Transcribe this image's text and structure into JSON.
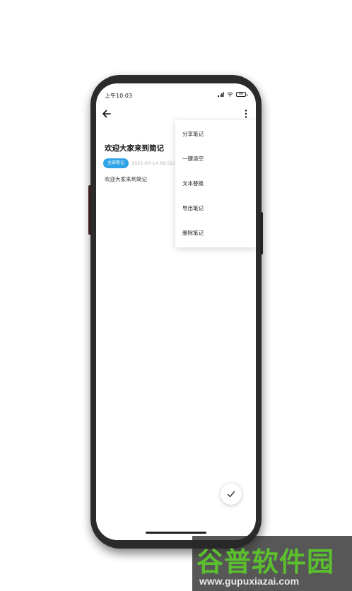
{
  "status_bar": {
    "time": "上午10:03",
    "battery": "86"
  },
  "note": {
    "title": "欢迎大家来到简记",
    "category": "全部笔记",
    "date": "2021-07-14 09:52:5",
    "body": "欢迎大家来到简记"
  },
  "menu": {
    "items": [
      {
        "label": "分享笔记"
      },
      {
        "label": "一键清空"
      },
      {
        "label": "文本替换"
      },
      {
        "label": "导出笔记"
      },
      {
        "label": "删除笔记"
      }
    ]
  },
  "colors": {
    "accent": "#2ea3e8",
    "watermark_green": "#5bbf2e"
  },
  "icons": {
    "back": "arrow-left-icon",
    "more": "more-vertical-icon",
    "confirm": "check-icon"
  },
  "watermark": {
    "name": "谷普软件园",
    "url": "www.gupuxiazai.com"
  }
}
